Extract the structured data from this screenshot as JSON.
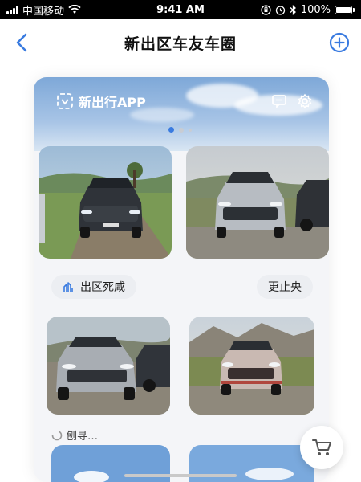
{
  "status_bar": {
    "carrier": "中国移动",
    "time": "9:41 AM",
    "battery": "100%"
  },
  "nav": {
    "title": "新出区车友车圈"
  },
  "banner": {
    "app_name": "新出行APP",
    "pager_active_index": 0,
    "pager_count": 3
  },
  "actions": {
    "left_pill": "出区死咸",
    "right_pill": "更止央"
  },
  "footer": {
    "label": "刨寻…"
  },
  "colors": {
    "accent": "#3a7be0",
    "pill_bg": "#eceef2"
  },
  "icons": [
    "back-icon",
    "add-circle-icon",
    "message-icon",
    "settings-icon",
    "chart-icon",
    "cart-icon"
  ]
}
